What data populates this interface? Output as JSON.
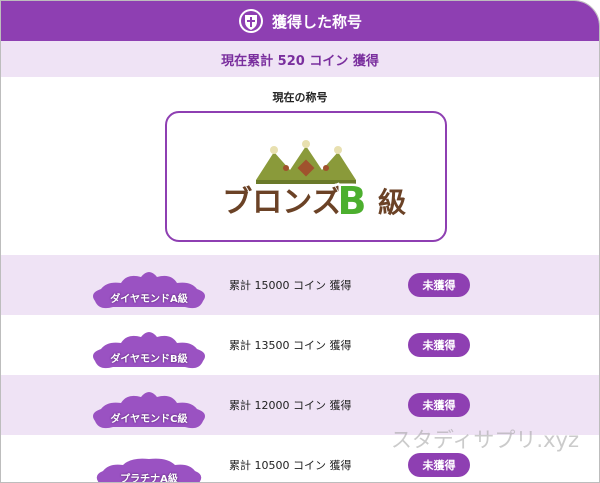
{
  "header": {
    "title": "獲得した称号",
    "icon": "shield-cross-icon"
  },
  "total": {
    "text": "現在累計 520 コイン 獲得"
  },
  "current": {
    "label": "現在の称号",
    "title_text": "ブロンズB級"
  },
  "titles": [
    {
      "badge_label": "ダイヤモンドA級",
      "requirement": "累計 15000 コイン 獲得",
      "status": "未獲得"
    },
    {
      "badge_label": "ダイヤモンドB級",
      "requirement": "累計 13500 コイン 獲得",
      "status": "未獲得"
    },
    {
      "badge_label": "ダイヤモンドC級",
      "requirement": "累計 12000 コイン 獲得",
      "status": "未獲得"
    },
    {
      "badge_label": "プラチナA級",
      "requirement": "累計 10500 コイン 獲得",
      "status": "未獲得"
    }
  ],
  "watermark": "スタディサプリ.xyz",
  "colors": {
    "accent": "#8e3fb2",
    "accent_light": "#efe3f5",
    "badge": "#9a52c2"
  }
}
